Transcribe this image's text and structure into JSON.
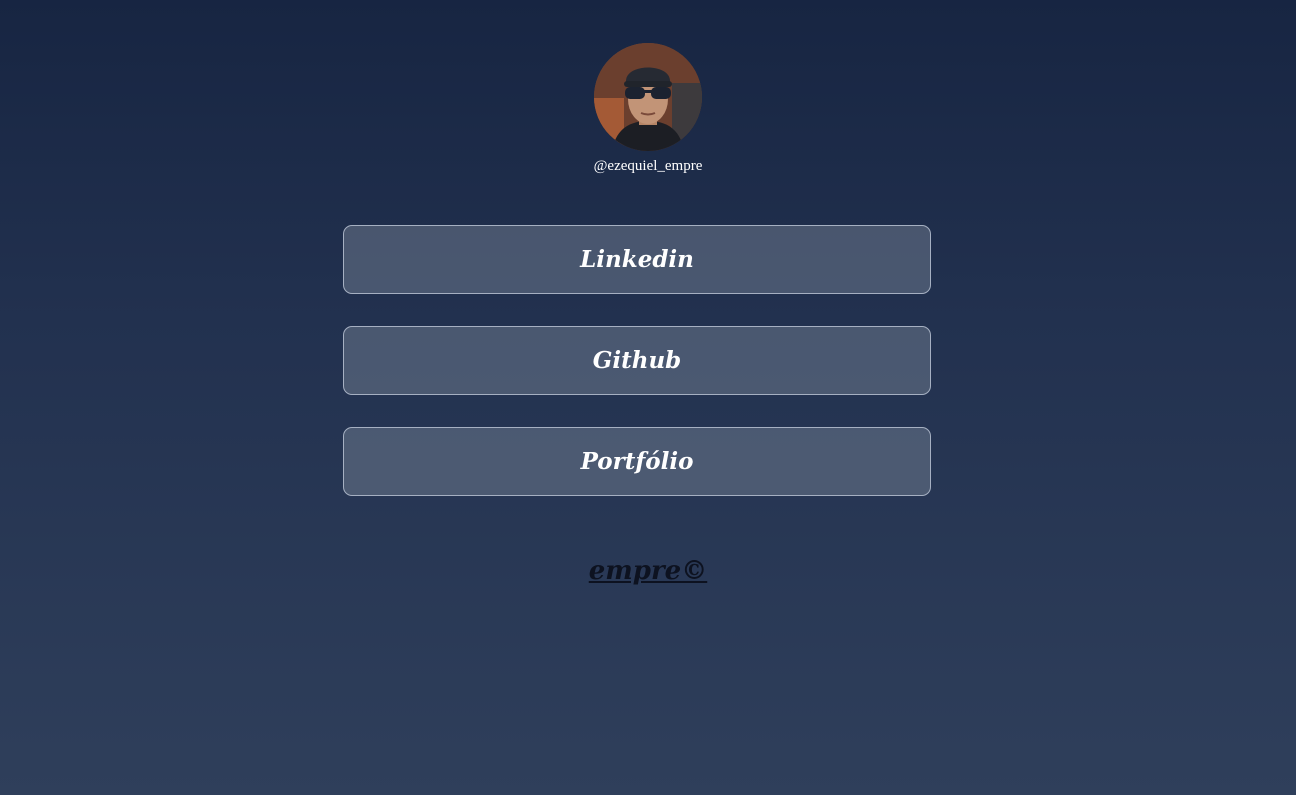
{
  "profile": {
    "avatar_icon": "person-photo",
    "handle": "@ezequiel_empre"
  },
  "links": [
    {
      "label": "Linkedin"
    },
    {
      "label": "Github"
    },
    {
      "label": "Portfólio"
    }
  ],
  "footer": {
    "text": "empre©"
  },
  "colors": {
    "background_top": "#172542",
    "background_bottom": "#2f3f5b",
    "button_fill": "#4a5870",
    "button_border": "#a6b0c2",
    "button_text": "#ffffff",
    "footer_text": "#0d1220"
  }
}
